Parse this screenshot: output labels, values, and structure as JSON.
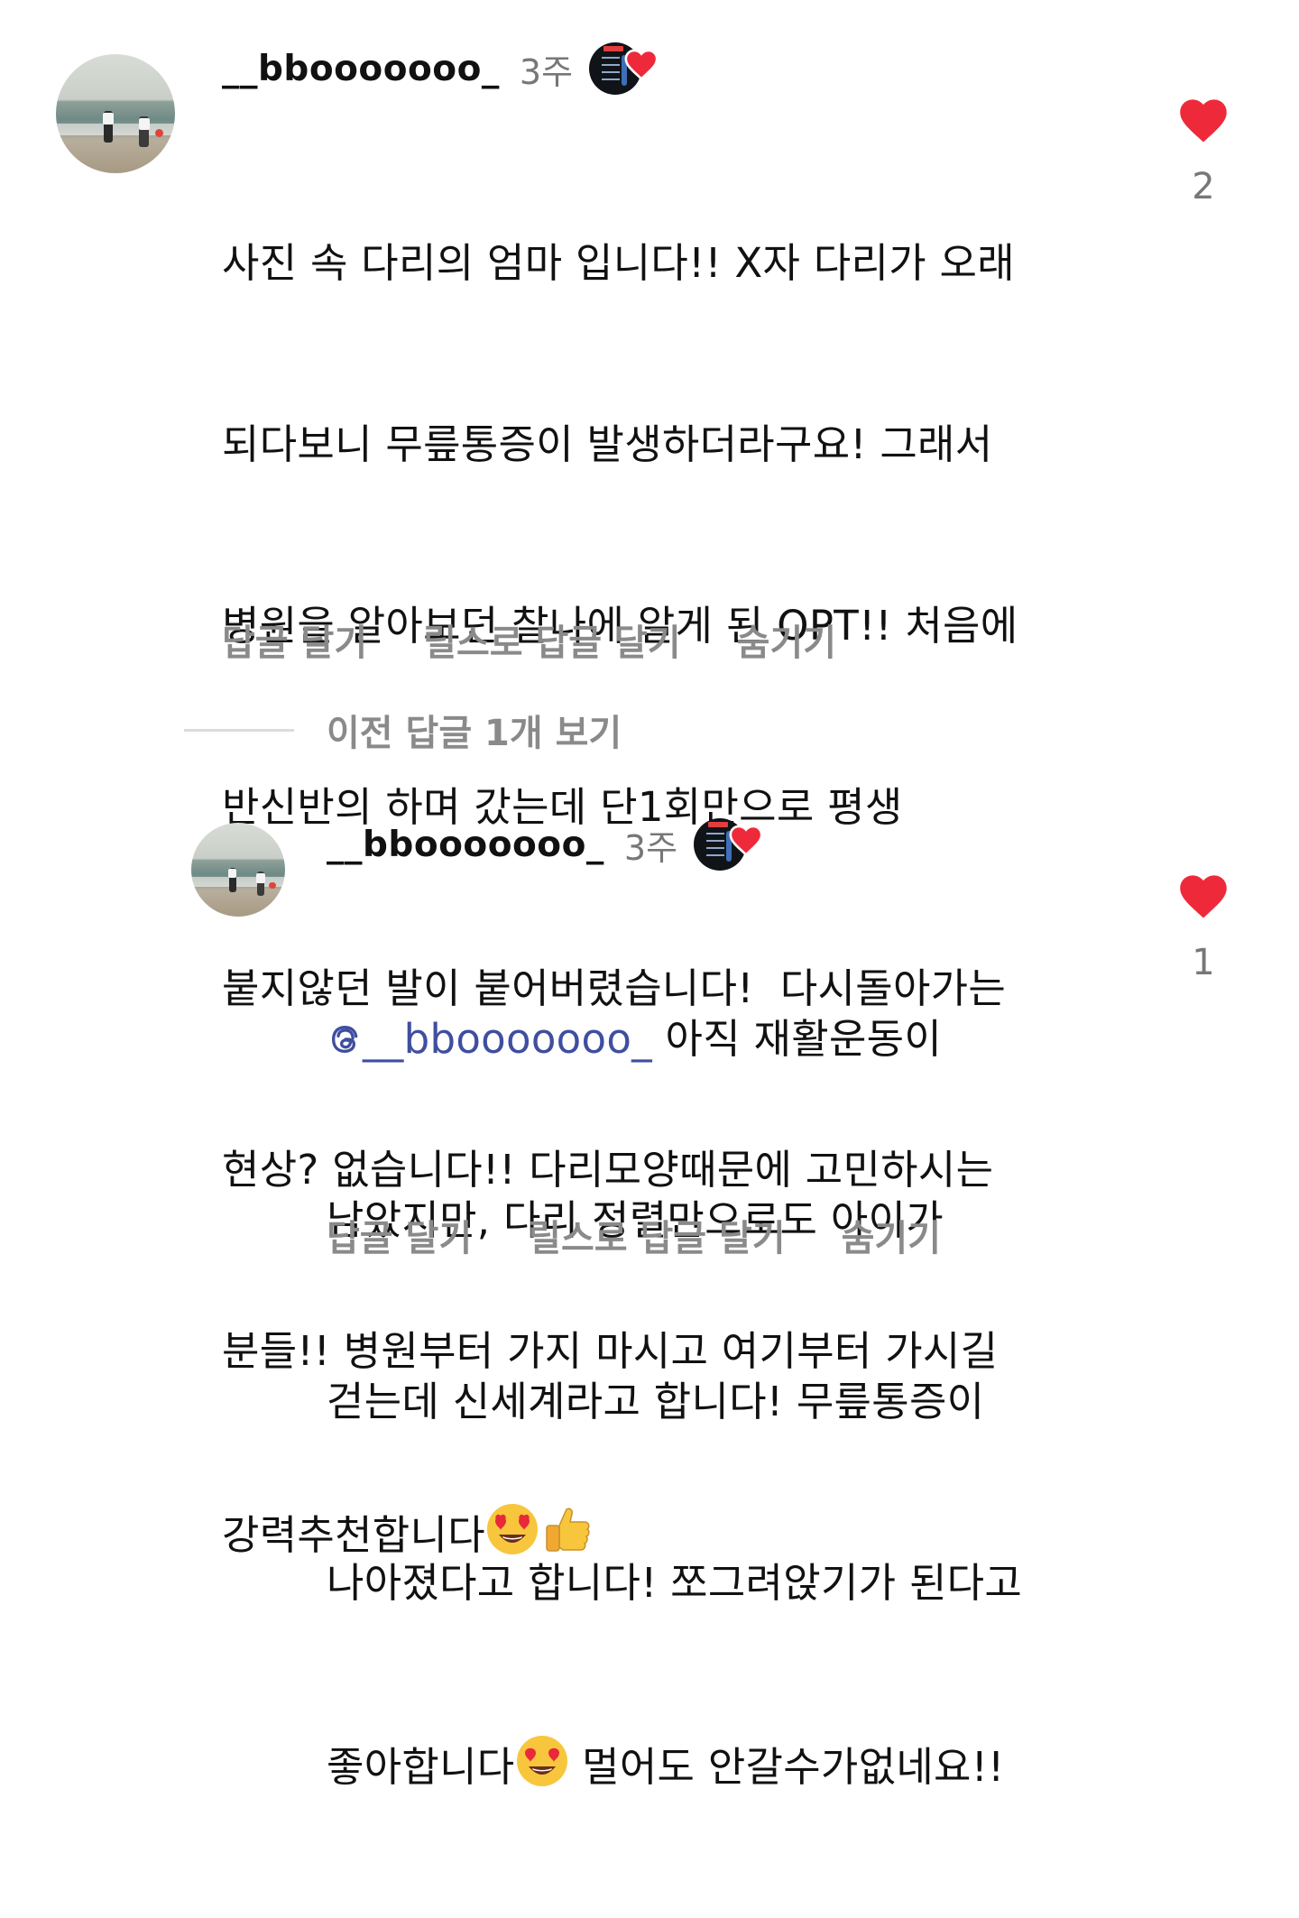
{
  "comments": [
    {
      "username": "__bbooooooo_",
      "time": "3주",
      "lines": [
        "사진 속 다리의 엄마 입니다!! X자 다리가 오래",
        "되다보니 무릎통증이 발생하더라구요! 그래서",
        "병원을 알아보던 찰나에 알게 된 OPT!! 처음에",
        "반신반의 하며 갔는데 단1회만으로 평생",
        "붙지않던 발이 붙어버렸습니다!  다시돌아가는",
        "현상? 없습니다!! 다리모양때문에 고민하시는",
        "분들!! 병원부터 가지 마시고 여기부터 가시길",
        "강력추천합니다"
      ],
      "likes": "2",
      "actions": {
        "reply": "답글 달기",
        "reels_reply": "릴스로 답글 달기",
        "hide": "숨기기"
      }
    },
    {
      "username": "__bbooooooo_",
      "time": "3주",
      "mention": "__bbooooooo_",
      "lines": [
        " 아직 재활운동이",
        "남았지만, 다리 정렬만으로도 아이가",
        "걷는데 신세계라고 합니다! 무릎통증이",
        "나아졌다고 합니다! 쪼그려앉기가 된다고",
        "좋아합니다",
        " 멀어도 안갈수가없네요!!"
      ],
      "likes": "1",
      "actions": {
        "reply": "답글 달기",
        "reels_reply": "릴스로 답글 달기",
        "hide": "숨기기"
      }
    }
  ],
  "previous_replies": "이전 답글 1개 보기",
  "icons": {
    "like": "heart-icon",
    "creator_badge": "creator-liked-badge-icon",
    "mention": "threads-mention-icon",
    "emoji_heart_eyes": "heart-eyes-emoji",
    "emoji_thumbs_up": "thumbs-up-emoji"
  },
  "colors": {
    "heart": "#ee2a3a",
    "mention": "#3f4ea0",
    "muted": "#8a8a8a"
  }
}
